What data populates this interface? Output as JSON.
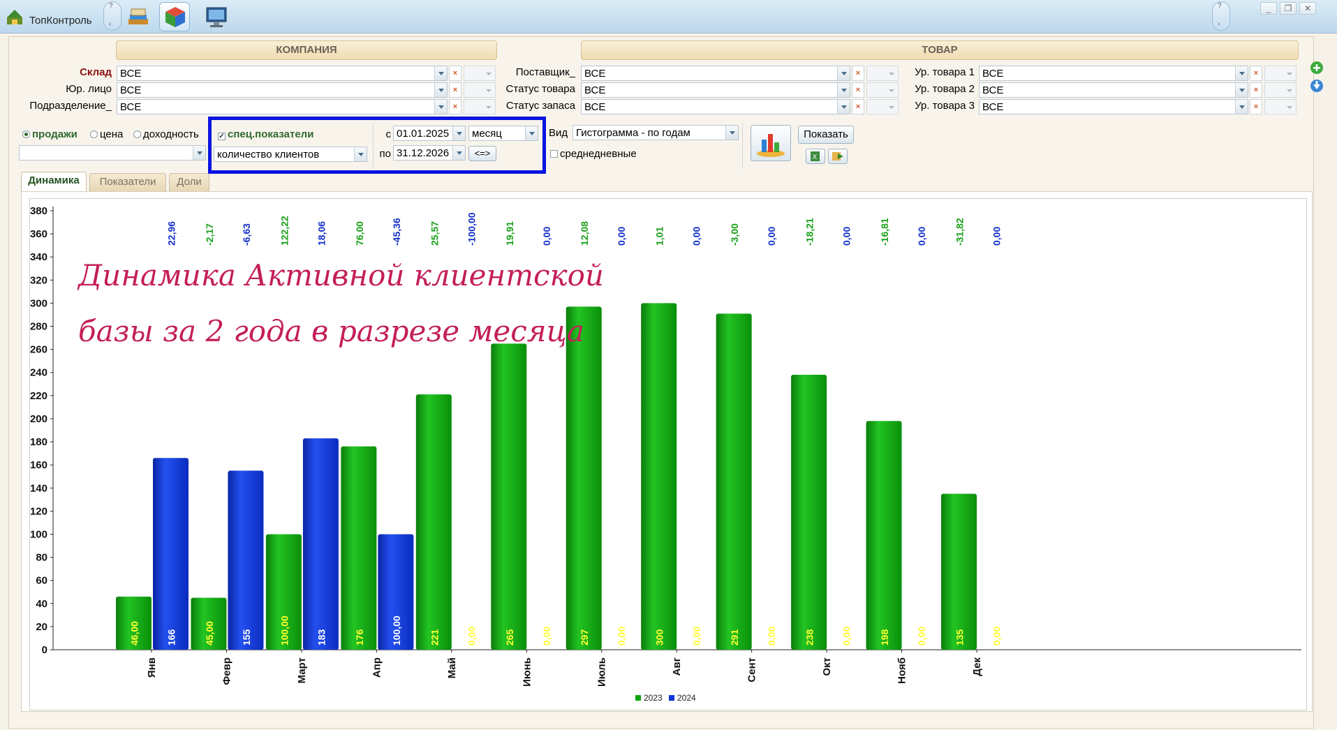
{
  "window": {
    "title": "ТопКонтроль",
    "nav_up": "?",
    "nav_down": "?",
    "controls": [
      "_",
      "❐",
      "✕"
    ]
  },
  "toolbar": {
    "icons": [
      "book-stack-icon",
      "cube-icon",
      "monitor-icon"
    ]
  },
  "company": {
    "header": "КОМПАНИЯ",
    "fields": [
      {
        "label": "Склад",
        "value": "ВСЕ",
        "emph": true
      },
      {
        "label": "Юр. лицо",
        "value": "ВСЕ"
      },
      {
        "label": "Подразделение_",
        "value": "ВСЕ"
      }
    ]
  },
  "product": {
    "header": "ТОВАР",
    "fields": [
      {
        "label": "Поставщик_",
        "value": "ВСЕ"
      },
      {
        "label": "Статус товара",
        "value": "ВСЕ"
      },
      {
        "label": "Статус запаса",
        "value": "ВСЕ"
      }
    ],
    "levels": [
      {
        "label": "Ур. товара 1",
        "value": "ВСЕ"
      },
      {
        "label": "Ур. товара 2",
        "value": "ВСЕ"
      },
      {
        "label": "Ур. товара 3",
        "value": "ВСЕ"
      }
    ]
  },
  "options": {
    "radios": [
      "продажи",
      "цена",
      "доходность"
    ],
    "radio_selected": "продажи",
    "spec_checkbox": "спец.показатели",
    "spec_checked": true,
    "spec_select": "количество клиентов",
    "date_from_label": "с",
    "date_from": "01.01.2025",
    "date_to_label": "по",
    "date_to": "31.12.2026",
    "period": "месяц",
    "swap_button": "<=>",
    "view_label": "Вид",
    "view_value": "Гистограмма - по годам",
    "avg_checkbox": "среднедневные",
    "show_button": "Показать",
    "extra_select": ""
  },
  "tabs": [
    "Динамика",
    "Показатели",
    "Доли"
  ],
  "active_tab": "Динамика",
  "annotation": {
    "line1": "Динамика Активной клиентской",
    "line2": "базы за 2 года в разрезе месяца",
    "color": "#c41e5a"
  },
  "colors": {
    "green": "#0fa40f",
    "blue": "#0d35d8",
    "label_green": "#19a019",
    "label_blue": "#1530c8"
  },
  "chart_data": {
    "type": "bar",
    "categories": [
      "Янв",
      "Февр",
      "Март",
      "Апр",
      "Май",
      "Июнь",
      "Июль",
      "Авг",
      "Сент",
      "Окт",
      "Нояб",
      "Дек"
    ],
    "series": [
      {
        "name": "2023",
        "values": [
          46,
          45,
          100,
          176,
          221,
          265,
          297,
          300,
          291,
          238,
          198,
          135
        ],
        "labels": [
          "46,00",
          "45,00",
          "100,00",
          "176",
          "221",
          "265",
          "297",
          "300",
          "291",
          "238",
          "198",
          "135"
        ]
      },
      {
        "name": "2024",
        "values": [
          166,
          155,
          183,
          100,
          0,
          0,
          0,
          0,
          0,
          0,
          0,
          0
        ],
        "labels": [
          "166",
          "155",
          "183",
          "100,00",
          "0,00",
          "0,00",
          "0,00",
          "0,00",
          "0,00",
          "0,00",
          "0,00",
          "0,00"
        ]
      }
    ],
    "top_labels": [
      {
        "green": "",
        "blue": "22,96"
      },
      {
        "green": "-2,17",
        "blue": "-6,63"
      },
      {
        "green": "122,22",
        "blue": "18,06"
      },
      {
        "green": "76,00",
        "blue": "-45,36"
      },
      {
        "green": "25,57",
        "blue": "-100,00"
      },
      {
        "green": "19,91",
        "blue": "0,00"
      },
      {
        "green": "12,08",
        "blue": "0,00"
      },
      {
        "green": "1,01",
        "blue": "0,00"
      },
      {
        "green": "-3,00",
        "blue": "0,00"
      },
      {
        "green": "-18,21",
        "blue": "0,00"
      },
      {
        "green": "-16,81",
        "blue": "0,00"
      },
      {
        "green": "-31,82",
        "blue": "0,00"
      }
    ],
    "ylim": [
      0,
      380
    ],
    "yticks": [
      0,
      20,
      40,
      60,
      80,
      100,
      120,
      140,
      160,
      180,
      200,
      220,
      240,
      260,
      280,
      300,
      320,
      340,
      360,
      380
    ],
    "grid": false,
    "legend": "bottom-center"
  }
}
